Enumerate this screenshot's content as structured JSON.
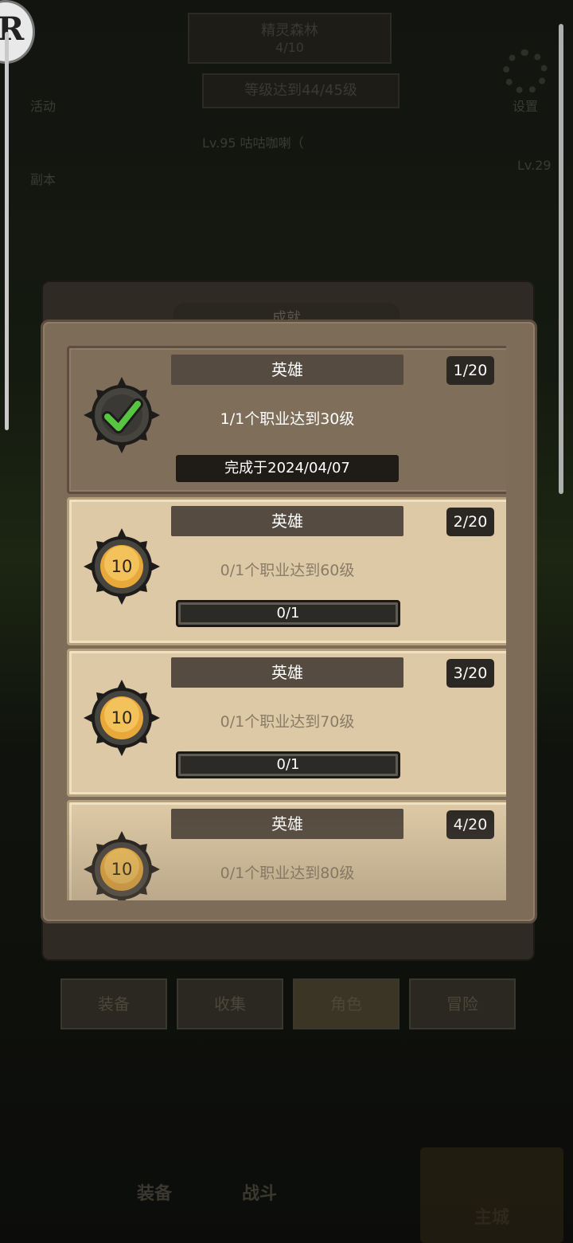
{
  "background": {
    "stage_name": "精灵森林",
    "stage_progress": "4/10",
    "quest_text": "等级达到44/45级",
    "player_text": "Lv.95 咕咕咖喇（",
    "right_level": "Lv.29",
    "menu_activity": "活动",
    "menu_dungeon": "副本",
    "menu_settings": "设置",
    "sub_tabs": [
      "装备",
      "收集",
      "角色",
      "冒险"
    ],
    "bottom_nav": [
      "装备",
      "战斗",
      "主城"
    ]
  },
  "panel": {
    "tab_label": "成就",
    "cards": [
      {
        "title": "英雄",
        "count": "1/20",
        "desc": "1/1个职业达到30级",
        "status": "完成于2024/04/07",
        "done": true
      },
      {
        "title": "英雄",
        "count": "2/20",
        "desc": "0/1个职业达到60级",
        "reward": "10",
        "progress_text": "0/1",
        "progress": 0
      },
      {
        "title": "英雄",
        "count": "3/20",
        "desc": "0/1个职业达到70级",
        "reward": "10",
        "progress_text": "0/1",
        "progress": 0
      },
      {
        "title": "英雄",
        "count": "4/20",
        "desc": "0/1个职业达到80级",
        "reward": "10"
      }
    ]
  },
  "colors": {
    "medal_gold": "#e8a93a",
    "check_green": "#58c542",
    "card_done": "#7f6e5a",
    "card_todo": "#ddc9a5"
  }
}
